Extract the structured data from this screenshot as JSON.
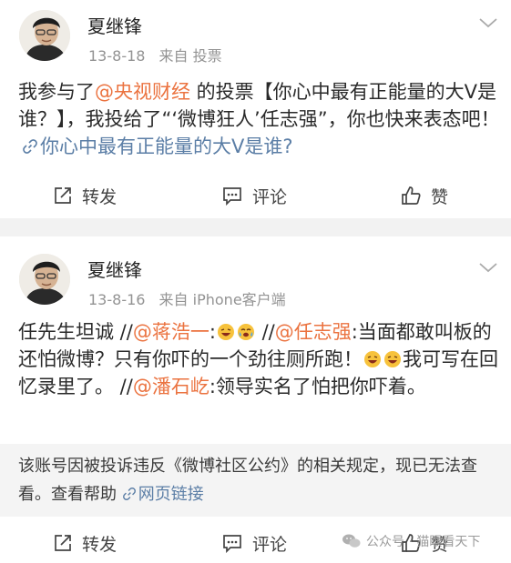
{
  "posts": [
    {
      "author": "夏继锋",
      "time": "13-8-18",
      "source_prefix": "来自",
      "source": "投票",
      "body": {
        "t1": "我参与了",
        "mention1": "@央视财经",
        "t2": " 的投票【你心中最有正能量的大V是谁？】，我投给了“‘微博狂人’任志强”，你也快来表态吧！",
        "link_text": "你心中最有正能量的大V是谁?"
      },
      "actions": {
        "repost": "转发",
        "comment": "评论",
        "like": "赞"
      }
    },
    {
      "author": "夏继锋",
      "time": "13-8-16",
      "source_prefix": "来自",
      "source": "iPhone客户端",
      "body": {
        "t1": "任先生坦诚 //",
        "mention1": "@蒋浩一",
        "t2": ":",
        "t3": " //",
        "mention2": "@任志强",
        "t4": ":当面都敢叫板的还怕微博？只有你吓的一个劲往厕所跑！",
        "t5": "我可写在回忆录里了。 //",
        "mention3": "@潘石屹",
        "t6": ":领导实名了怕把你吓着。"
      },
      "notice": {
        "text": "该账号因被投诉违反《微博社区公约》的相关规定，现已无法查看。查看帮助 ",
        "link": "网页链接"
      },
      "actions": {
        "repost": "转发",
        "comment": "评论",
        "like": "赞"
      }
    }
  ],
  "watermark": {
    "text": "公众号 · 猫眼看天下"
  },
  "colors": {
    "mention": "#eb7340",
    "link": "#5b7ea6",
    "meta": "#939393",
    "background": "#f2f2f2"
  },
  "icons": [
    "avatar",
    "chevron-down-icon",
    "link-icon",
    "repost-icon",
    "comment-icon",
    "like-icon",
    "laugh-emoji",
    "tears-emoji",
    "wechat-icon"
  ]
}
